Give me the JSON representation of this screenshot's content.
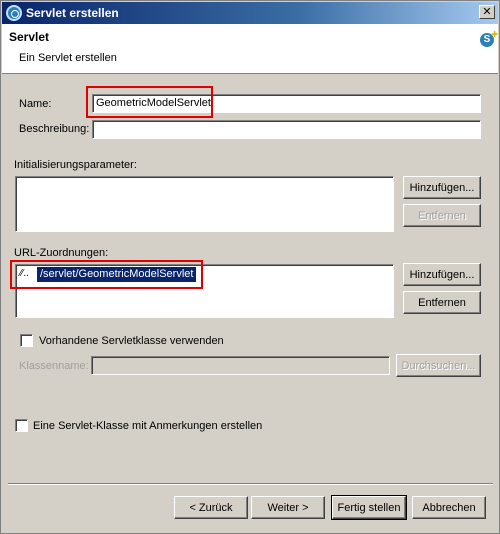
{
  "window": {
    "title": "Servlet erstellen",
    "close_label": "✕"
  },
  "banner": {
    "title": "Servlet",
    "description": "Ein Servlet erstellen"
  },
  "form": {
    "name_label": "Name:",
    "name_value": "GeometricModelServlet",
    "description_label": "Beschreibung:",
    "description_value": "",
    "init_params_label": "Initialisierungsparameter:",
    "init_add_label": "Hinzufügen...",
    "init_remove_label": "Entfernen",
    "url_mappings_label": "URL-Zuordnungen:",
    "url_mappings": [
      "/servlet/GeometricModelServlet"
    ],
    "url_add_label": "Hinzufügen...",
    "url_remove_label": "Entfernen",
    "existing_class_label": "Vorhandene Servletklasse verwenden",
    "existing_class_checked": false,
    "class_name_label": "Klassenname:",
    "class_name_value": "",
    "browse_label": "Durchsuchen...",
    "annotations_label": "Eine Servlet-Klasse mit Anmerkungen erstellen",
    "annotations_checked": false
  },
  "buttons": {
    "back_label": "< Zurück",
    "next_label": "Weiter >",
    "finish_label": "Fertig stellen",
    "cancel_label": "Abbrechen"
  },
  "colors": {
    "title_gradient_start": "#0a246a",
    "selection": "#0a246a",
    "highlight_box": "#e00000",
    "dialog_bg": "#d4d0c8"
  }
}
